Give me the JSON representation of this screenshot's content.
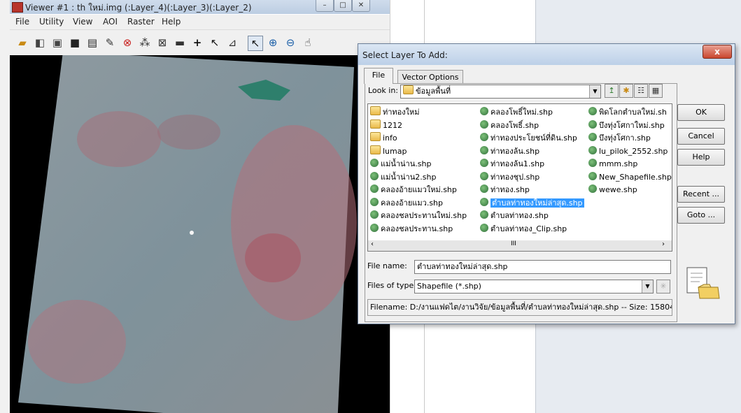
{
  "viewer": {
    "title": "Viewer #1 : th ใหม่.img (:Layer_4)(:Layer_3)(:Layer_2)",
    "menu": [
      "File",
      "Utility",
      "View",
      "AOI",
      "Raster",
      "Help"
    ],
    "window_controls": [
      "–",
      "□",
      "✕"
    ],
    "toolbar_icons": [
      "open-folder-icon",
      "open-file-icon",
      "info-icon",
      "save-icon",
      "print-icon",
      "eraser-icon",
      "clear-icon",
      "fit-icon",
      "pan-icon",
      "measure-icon",
      "crosshair-icon",
      "inquire-icon",
      "profile-icon",
      "pointer-icon",
      "zoom-in-icon",
      "zoom-out-icon",
      "hand-icon"
    ]
  },
  "dialog": {
    "title": "Select Layer To Add:",
    "close_label": "x",
    "tabs": [
      "File",
      "Vector Options"
    ],
    "look_in_label": "Look in:",
    "look_in_value": "ข้อมูลพื้นที่",
    "files": [
      {
        "name": "ท่าทองใหม่",
        "kind": "folder"
      },
      {
        "name": "1212",
        "kind": "folder"
      },
      {
        "name": "info",
        "kind": "folder"
      },
      {
        "name": "lumap",
        "kind": "folder"
      },
      {
        "name": "แม่น้ำน่าน.shp",
        "kind": "shape"
      },
      {
        "name": "แม่น้ำน่าน2.shp",
        "kind": "shape"
      },
      {
        "name": "คลองอ้ายแมวใหม่.shp",
        "kind": "shape"
      },
      {
        "name": "คลองอ้ายแมว.shp",
        "kind": "shape"
      },
      {
        "name": "คลองชลประทานใหม่.shp",
        "kind": "shape"
      },
      {
        "name": "คลองชลประทาน.shp",
        "kind": "shape"
      },
      {
        "name": "คลองโพธิ์ใหม่.shp",
        "kind": "shape"
      },
      {
        "name": "คลองโพธิ์.shp",
        "kind": "shape"
      },
      {
        "name": "ท่าทองประโยชน์ที่ดิน.shp",
        "kind": "shape"
      },
      {
        "name": "ท่าทองล้น.shp",
        "kind": "shape"
      },
      {
        "name": "ท่าทองล้น1.shp",
        "kind": "shape"
      },
      {
        "name": "ท่าทองชุป.shp",
        "kind": "shape"
      },
      {
        "name": "ท่าทอง.shp",
        "kind": "shape"
      },
      {
        "name": "ตำบลท่าทองใหม่ล่าสุด.shp",
        "kind": "shape",
        "selected": true
      },
      {
        "name": "ตำบลท่าทอง.shp",
        "kind": "shape"
      },
      {
        "name": "ตำบลท่าทอง_Clip.shp",
        "kind": "shape"
      },
      {
        "name": "พิดโลกตำบลใหม่.sh",
        "kind": "shape"
      },
      {
        "name": "บึงทุ่งโศกาใหม่.shp",
        "kind": "shape"
      },
      {
        "name": "บึงทุ่งโศกา.shp",
        "kind": "shape"
      },
      {
        "name": "lu_pilok_2552.shp",
        "kind": "shape"
      },
      {
        "name": "mmm.shp",
        "kind": "shape"
      },
      {
        "name": "New_Shapefile.shp",
        "kind": "shape"
      },
      {
        "name": "wewe.shp",
        "kind": "shape"
      }
    ],
    "scroll_left": "‹",
    "scroll_right": "›",
    "scroll_grip": "III",
    "file_name_label": "File name:",
    "file_name_value": "ตำบลท่าทองใหม่ล่าสุด.shp",
    "file_type_label": "Files of type:",
    "file_type_value": "Shapefile (*.shp)",
    "status_text": "Filename: D:/งานแฟดไต/งานวิจัย/ข้อมูลพื้นที่/ตำบลท่าทองใหม่ล่าสุด.shp -- Size: 15804",
    "buttons": {
      "ok": "OK",
      "cancel": "Cancel",
      "help": "Help",
      "recent": "Recent ...",
      "goto": "Goto ..."
    }
  }
}
